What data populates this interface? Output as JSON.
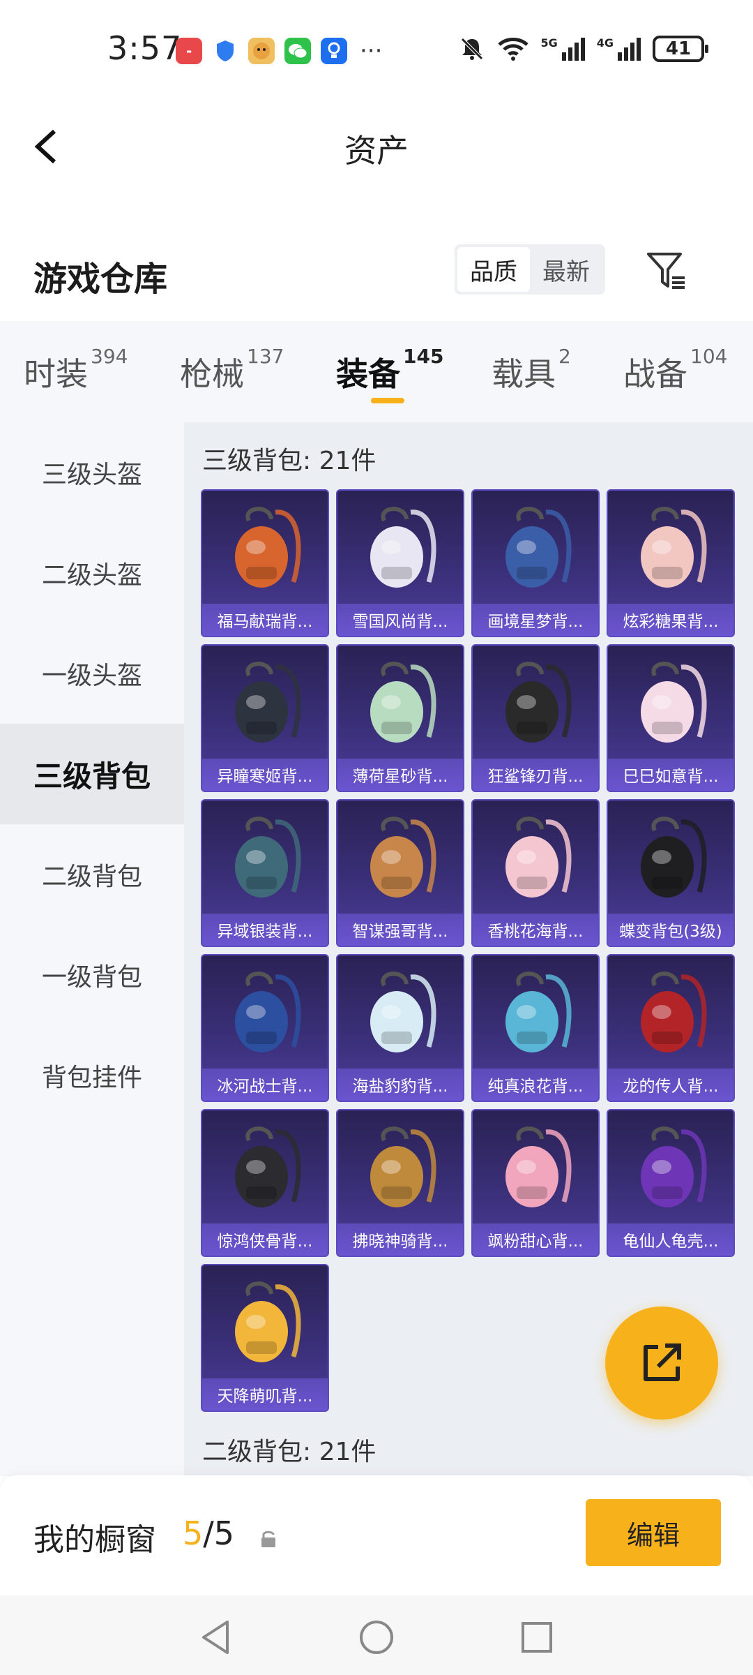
{
  "status_bar": {
    "time": "3:57",
    "battery": "41",
    "net1": "5G",
    "net2": "4G",
    "app_icons": [
      "huawei-store-icon",
      "shield-icon",
      "doge-app-icon",
      "wechat-icon",
      "bulb-app-icon"
    ],
    "more": "···"
  },
  "header": {
    "title": "资产"
  },
  "section": {
    "title": "游戏仓库",
    "sort_quality": "品质",
    "sort_newest": "最新"
  },
  "tabs": [
    {
      "label": "时装",
      "count": "394"
    },
    {
      "label": "枪械",
      "count": "137"
    },
    {
      "label": "装备",
      "count": "145"
    },
    {
      "label": "载具",
      "count": "2"
    },
    {
      "label": "战备",
      "count": "104"
    }
  ],
  "sidebar": {
    "items": [
      "三级头盔",
      "二级头盔",
      "一级头盔",
      "三级背包",
      "二级背包",
      "一级背包",
      "背包挂件"
    ]
  },
  "content": {
    "group1_label": "三级背包: 21件",
    "group2_label": "二级背包: 21件",
    "items": [
      {
        "name": "福马献瑞背...",
        "icon": "horse-backpack-icon",
        "color": "#d8642e"
      },
      {
        "name": "雪国风尚背...",
        "icon": "penguin-backpack-icon",
        "color": "#e8e6f2"
      },
      {
        "name": "画境星梦背...",
        "icon": "frame-backpack-icon",
        "color": "#3b5ea8"
      },
      {
        "name": "炫彩糖果背...",
        "icon": "candy-backpack-icon",
        "color": "#f2c7c2"
      },
      {
        "name": "异瞳寒姬背...",
        "icon": "cat-backpack-icon",
        "color": "#2e3340"
      },
      {
        "name": "薄荷星砂背...",
        "icon": "mint-backpack-icon",
        "color": "#b8dcc0"
      },
      {
        "name": "狂鲨锋刃背...",
        "icon": "shark-backpack-icon",
        "color": "#2a2a2a"
      },
      {
        "name": "巳巳如意背...",
        "icon": "snake-backpack-icon",
        "color": "#f4dbe6"
      },
      {
        "name": "异域银装背...",
        "icon": "mech-backpack-icon",
        "color": "#3f6a7a"
      },
      {
        "name": "智谋强哥背...",
        "icon": "hamster-backpack-icon",
        "color": "#c8864a"
      },
      {
        "name": "香桃花海背...",
        "icon": "peach-backpack-icon",
        "color": "#f4c6d0"
      },
      {
        "name": "蝶变背包(3级)",
        "icon": "butterfly-backpack-icon",
        "color": "#1f1f22"
      },
      {
        "name": "冰河战士背...",
        "icon": "warrior-backpack-icon",
        "color": "#2d4fa0"
      },
      {
        "name": "海盐豹豹背...",
        "icon": "seal-backpack-icon",
        "color": "#d7ecf5"
      },
      {
        "name": "纯真浪花背...",
        "icon": "wave-backpack-icon",
        "color": "#59b6d6"
      },
      {
        "name": "龙的传人背...",
        "icon": "dragon-backpack-icon",
        "color": "#b32428"
      },
      {
        "name": "惊鸿侠骨背...",
        "icon": "knight-backpack-icon",
        "color": "#2b2b30"
      },
      {
        "name": "拂晓神骑背...",
        "icon": "golden-backpack-icon",
        "color": "#c08a3c"
      },
      {
        "name": "飒粉甜心背...",
        "icon": "pink-backpack-icon",
        "color": "#f1a6bd"
      },
      {
        "name": "龟仙人龟壳...",
        "icon": "turtle-shell-backpack-icon",
        "color": "#6e36b6"
      },
      {
        "name": "天降萌叽背...",
        "icon": "yellow-backpack-icon",
        "color": "#f2b63a"
      }
    ]
  },
  "window": {
    "label": "我的橱窗",
    "count_current": "5",
    "count_total": "/5",
    "edit": "编辑"
  },
  "colors": {
    "accent": "#f7b21b",
    "card_bg": "#3a2f78",
    "card_name_bg": "#6b55d0"
  }
}
